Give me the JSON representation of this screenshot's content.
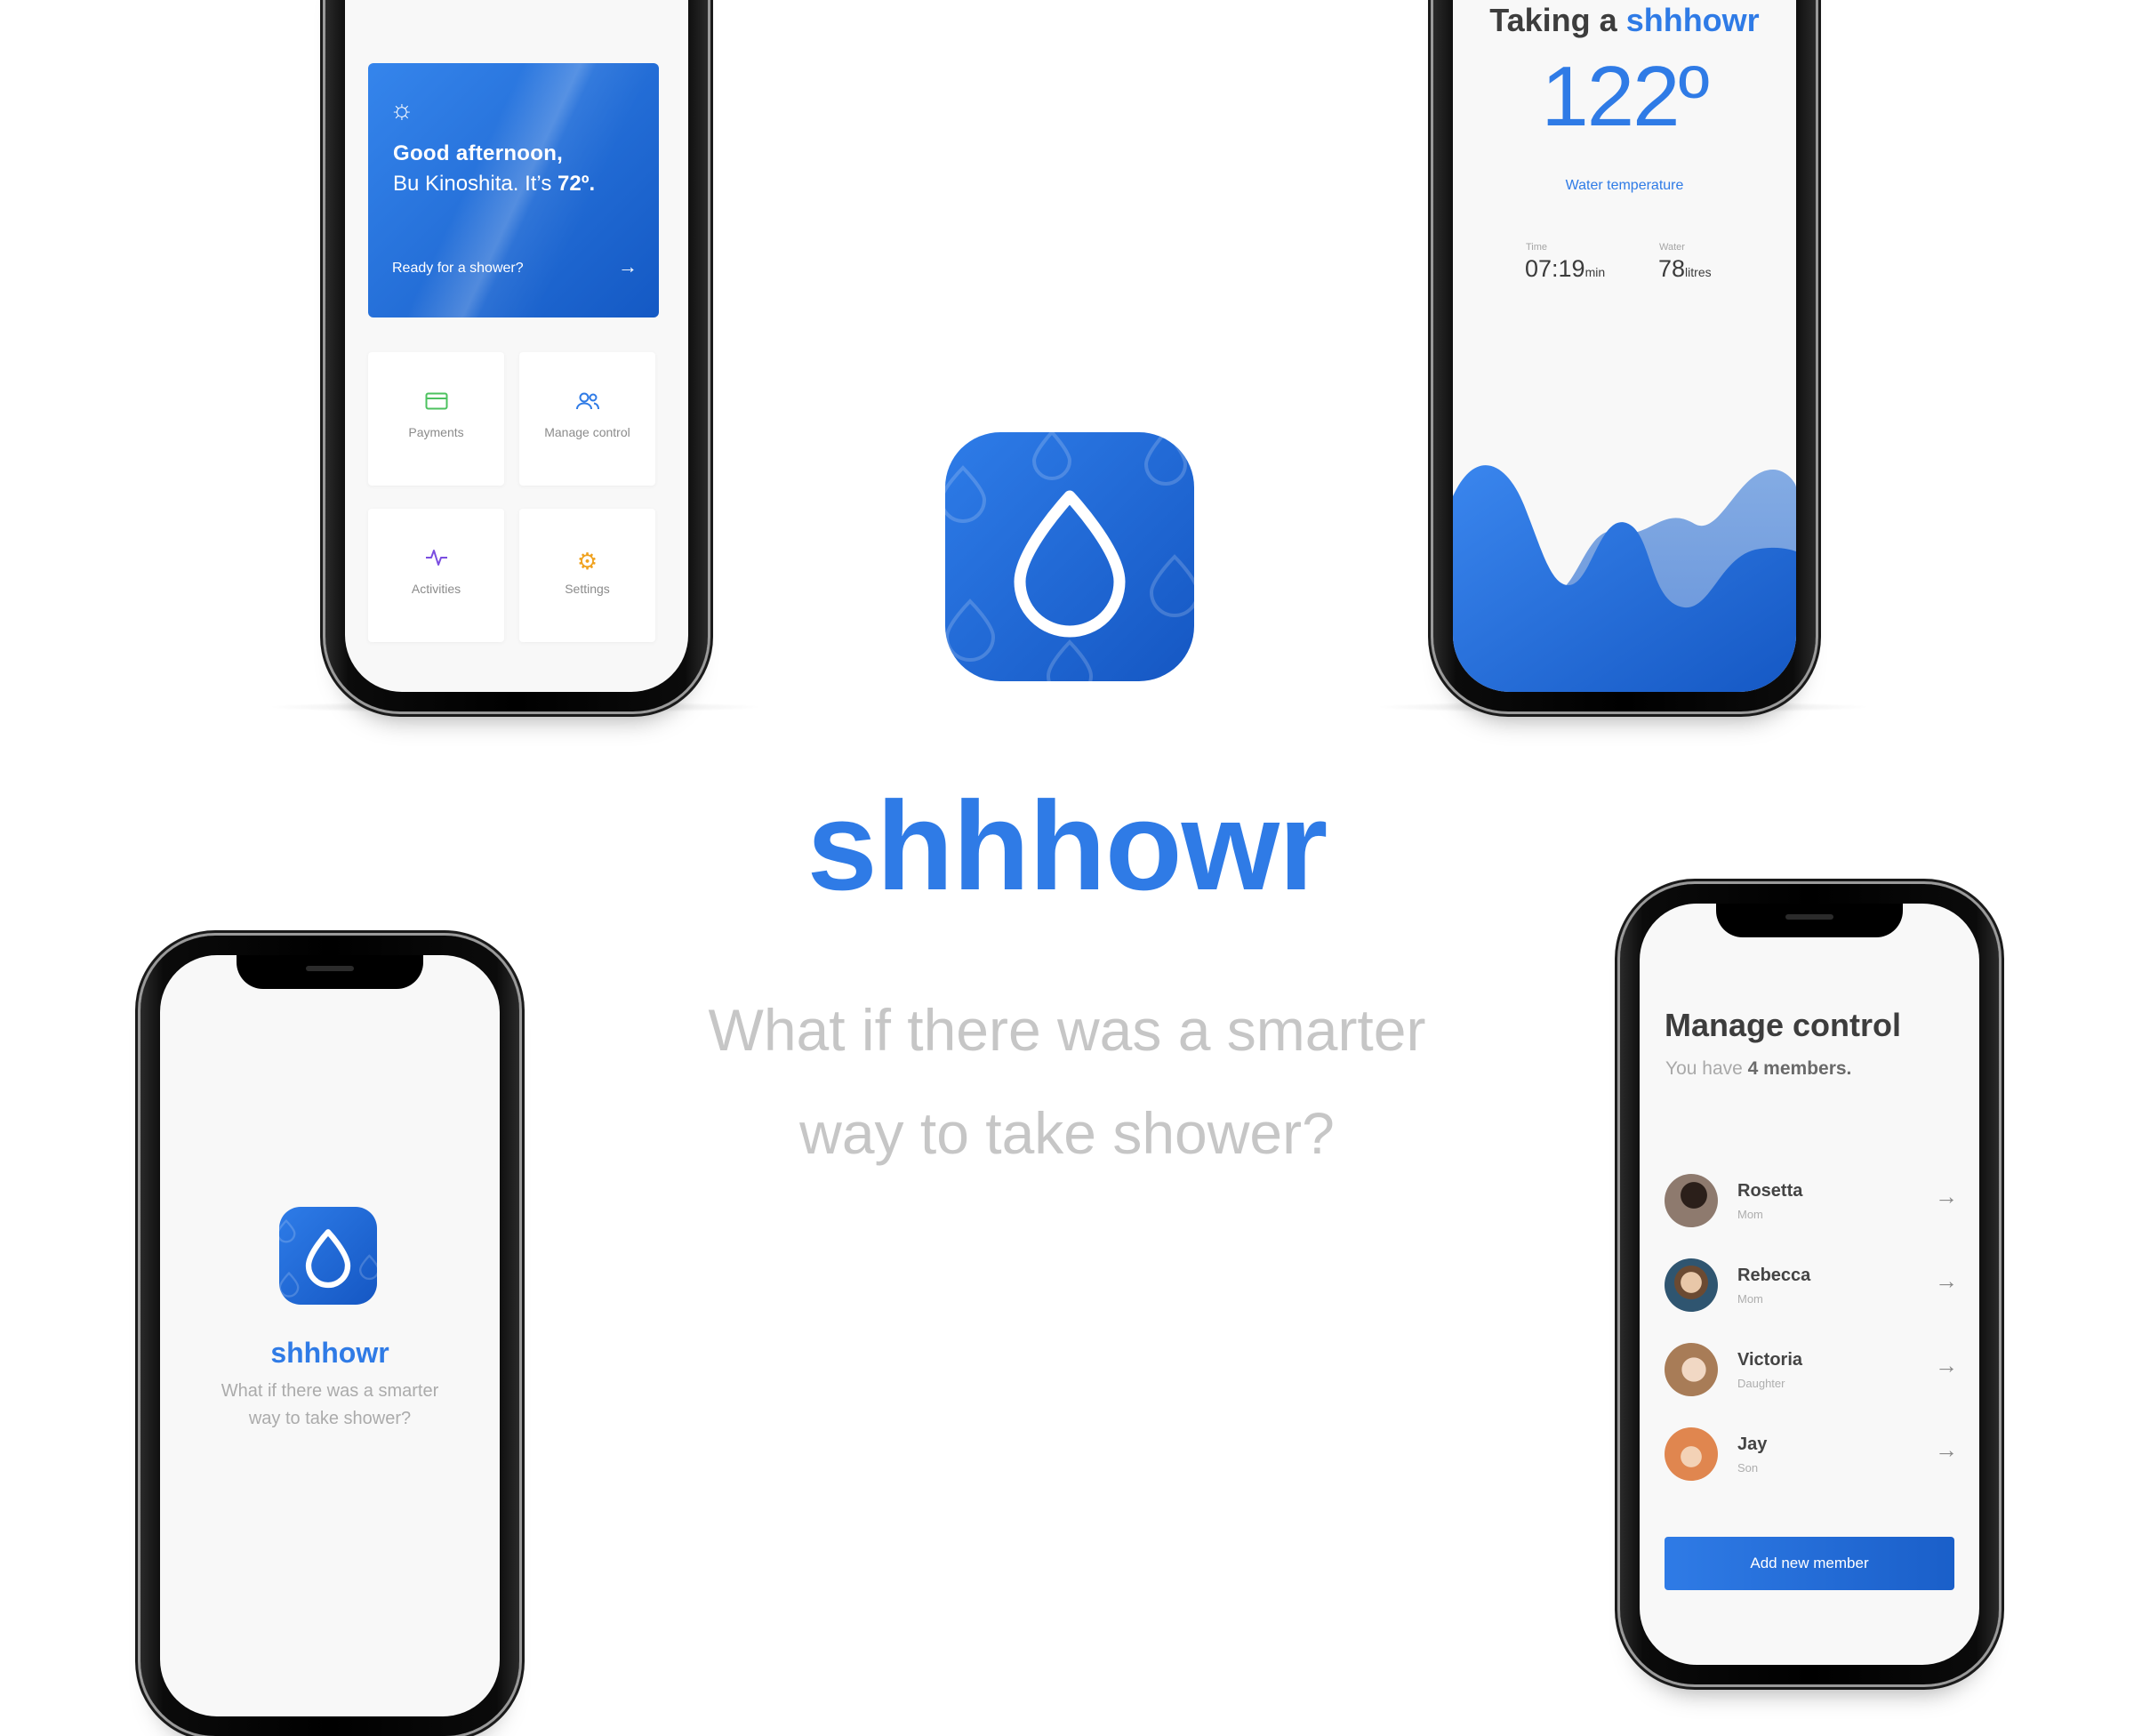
{
  "brand": {
    "name": "shhhowr",
    "tagline_line1": "What if there was a smarter",
    "tagline_line2": "way to take shower?",
    "accent_color": "#2f7be6",
    "icon": "water-drop-icon"
  },
  "dashboard": {
    "greeting_line1": "Good afternoon,",
    "greeting_name": "Bu Kinoshita. It’s",
    "greeting_temp": "72º.",
    "prompt": "Ready for a shower?",
    "prompt_icon": "arrow-right-icon",
    "weather_icon": "sun-icon",
    "tiles": [
      {
        "label": "Payments",
        "icon": "credit-card-icon",
        "color": "#4cc25f"
      },
      {
        "label": "Manage control",
        "icon": "users-icon",
        "color": "#2f7be6"
      },
      {
        "label": "Activities",
        "icon": "activity-icon",
        "color": "#7a4de0"
      },
      {
        "label": "Settings",
        "icon": "gear-icon",
        "color": "#f0a21f"
      }
    ]
  },
  "shower": {
    "title_prefix": "Taking a",
    "title_brand": "shhhowr",
    "temperature": "122º",
    "temperature_label": "Water temperature",
    "time_label": "Time",
    "time_value": "07:19",
    "time_unit": "min",
    "water_label": "Water",
    "water_value": "78",
    "water_unit": "litres"
  },
  "splash": {
    "brand": "shhhowr",
    "tagline_line1": "What if there was a smarter",
    "tagline_line2": "way to take shower?"
  },
  "manage": {
    "title": "Manage control",
    "subtitle_prefix": "You have",
    "subtitle_count": "4 members.",
    "members": [
      {
        "name": "Rosetta",
        "role": "Mom",
        "avatar_color": "#6b5a4e"
      },
      {
        "name": "Rebecca",
        "role": "Mom",
        "avatar_color": "#3d5a6e"
      },
      {
        "name": "Victoria",
        "role": "Daughter",
        "avatar_color": "#b89377"
      },
      {
        "name": "Jay",
        "role": "Son",
        "avatar_color": "#d97b4a"
      }
    ],
    "add_button": "Add new member",
    "row_icon": "arrow-right-icon"
  }
}
